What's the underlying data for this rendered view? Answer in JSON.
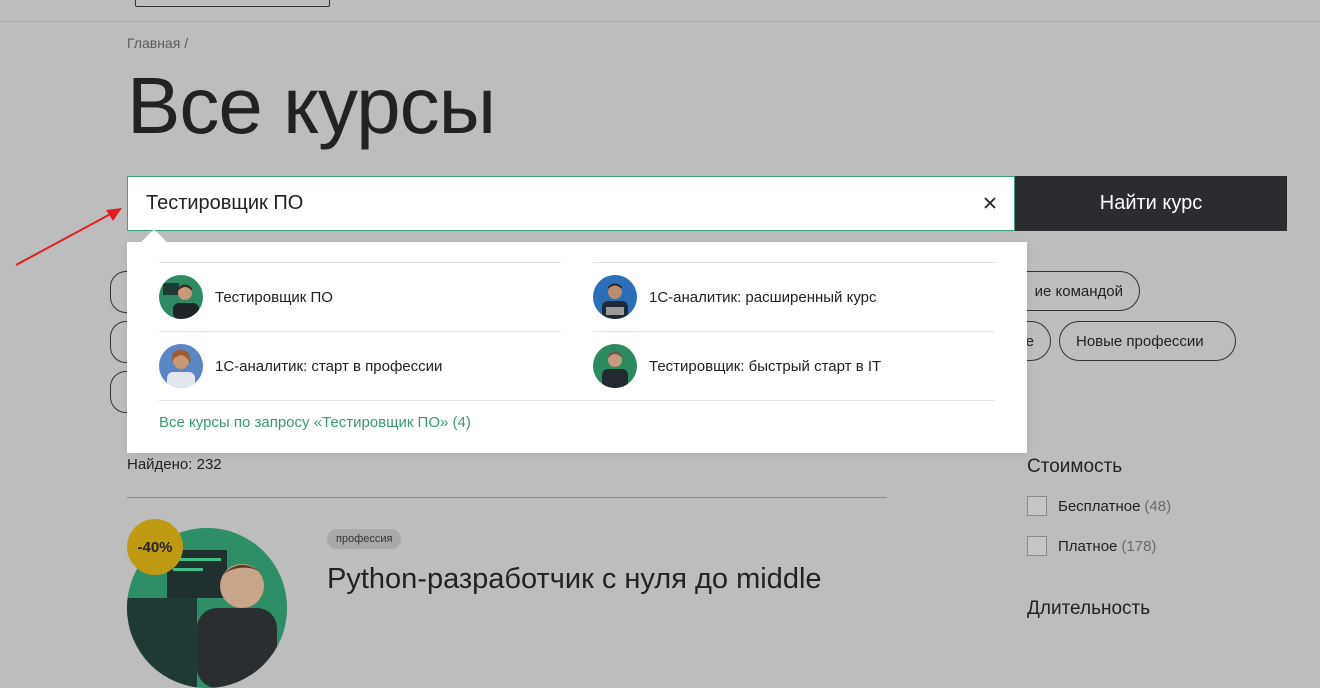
{
  "breadcrumb": {
    "home": "Главная",
    "separator": "/"
  },
  "page": {
    "title": "Все курсы"
  },
  "search": {
    "value": "Тестировщик ПО",
    "placeholder": "",
    "clear_icon": "close-icon",
    "button_label": "Найти курс"
  },
  "suggestions": {
    "items": [
      {
        "label": "Тестировщик ПО"
      },
      {
        "label": "1С-аналитик: расширенный курс"
      },
      {
        "label": "1С-аналитик: старт в профессии"
      },
      {
        "label": "Тестировщик: быстрый старт в IT"
      }
    ],
    "all_link": "Все курсы по запросу «Тестировщик ПО» (4)"
  },
  "chips": [
    {
      "label": "ие командой"
    },
    {
      "label": "е"
    },
    {
      "label": "Новые профессии"
    }
  ],
  "results": {
    "found": "Найдено: 232"
  },
  "filters": {
    "cost": {
      "title": "Стоимость",
      "options": [
        {
          "label": "Бесплатное",
          "count": "(48)"
        },
        {
          "label": "Платное",
          "count": "(178)"
        }
      ]
    },
    "duration": {
      "title": "Длительность"
    }
  },
  "course": {
    "discount": "-40%",
    "tag": "профессия",
    "title": "Python-разработчик с нуля до middle"
  },
  "colors": {
    "background": "#bdbdbd",
    "accent_green": "#3ca27a",
    "dark_button": "#2b2c30",
    "discount_yellow": "#c09a12",
    "annotation_arrow": "#e02020"
  }
}
